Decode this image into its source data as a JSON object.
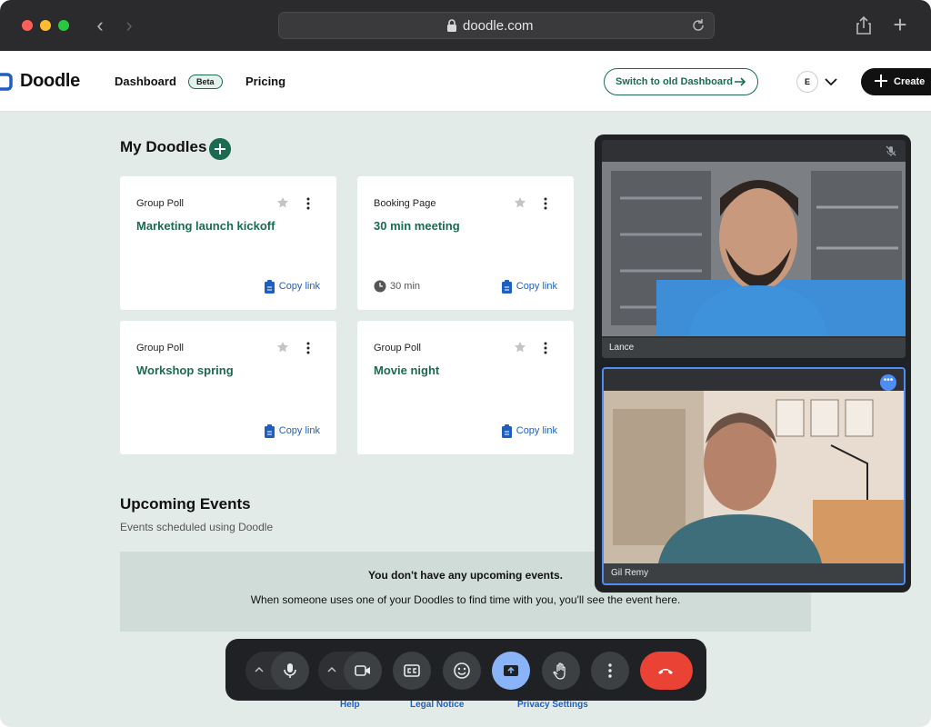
{
  "browser": {
    "url": "doodle.com"
  },
  "header": {
    "brand": "Doodle",
    "nav_dashboard": "Dashboard",
    "beta_badge": "Beta",
    "nav_pricing": "Pricing",
    "switch_label": "Switch to old Dashboard",
    "avatar_initial": "E",
    "create_label": "Create"
  },
  "my_doodles": {
    "title": "My Doodles",
    "cards": [
      {
        "type": "Group Poll",
        "title": "Marketing launch kickoff",
        "copy": "Copy link"
      },
      {
        "type": "Booking Page",
        "title": "30 min meeting",
        "duration": "30 min",
        "copy": "Copy link"
      },
      {
        "type": "Group Poll",
        "title": "Workshop spring",
        "copy": "Copy link"
      },
      {
        "type": "Group Poll",
        "title": "Movie night",
        "copy": "Copy link"
      }
    ]
  },
  "events": {
    "title": "Upcoming Events",
    "subtitle": "Events scheduled using Doodle",
    "empty_heading": "You don't have any upcoming events.",
    "empty_text": "When someone uses one of your Doodles to find time with you, you'll see the event here."
  },
  "footer": {
    "help": "Help",
    "legal": "Legal Notice",
    "privacy": "Privacy Settings"
  },
  "call": {
    "participants": [
      {
        "name": "Lance"
      },
      {
        "name": "Gil Remy"
      }
    ]
  },
  "colors": {
    "brand_green": "#1a6b4f",
    "link_blue": "#1f5fbf",
    "page_bg": "#e3ebe8",
    "hangup_red": "#ea4335",
    "present_blue": "#8ab4f8"
  }
}
